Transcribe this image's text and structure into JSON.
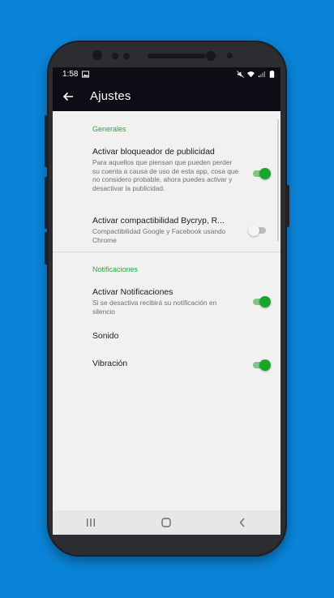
{
  "status_bar": {
    "time": "1:58",
    "icons": [
      "image-icon",
      "mute-icon",
      "wifi-icon",
      "signal-icon",
      "battery-icon"
    ]
  },
  "app_bar": {
    "back_icon": "arrow-left-icon",
    "title": "Ajustes"
  },
  "colors": {
    "accent": "#28a745",
    "toolbar": "#0d0d16",
    "switch_on": "#1aa52a",
    "background": "#0a84d8"
  },
  "sections": {
    "general": {
      "header": "Generales",
      "items": [
        {
          "title": "Activar bloqueador de publicidad",
          "summary": "Para aquellos que piensan que pueden perder su cuenta a causa de uso de esta app, cosa que no considero probable, ahora puedes activar y desactivar la publicidad.",
          "checked": true
        },
        {
          "title": "Activar compactibilidad Bycryp, R...",
          "summary": "Compactibilidad Google y Facebook usando Chrome",
          "checked": false
        }
      ]
    },
    "notifications": {
      "header": "Notificaciones",
      "items": [
        {
          "title": "Activar Notificaciones",
          "summary": "Si se desactiva recibirá su notificación en silencio",
          "checked": true
        },
        {
          "title": "Sonido"
        },
        {
          "title": "Vibración",
          "checked": true
        }
      ]
    }
  },
  "nav_bar": {
    "icons": [
      "recents-icon",
      "home-icon",
      "back-nav-icon"
    ]
  }
}
